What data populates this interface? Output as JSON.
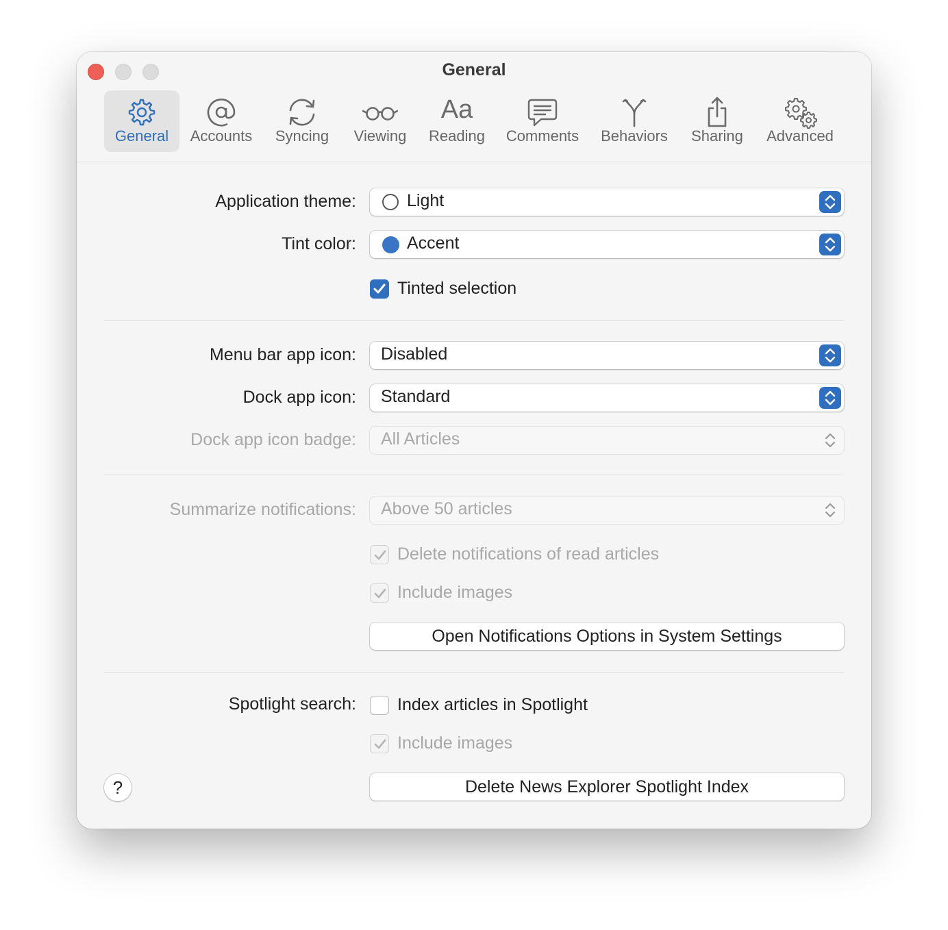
{
  "window": {
    "title": "General"
  },
  "toolbar": {
    "tabs": [
      {
        "label": "General",
        "icon": "gear-icon",
        "active": true
      },
      {
        "label": "Accounts",
        "icon": "at-sign-icon"
      },
      {
        "label": "Syncing",
        "icon": "sync-arrows-icon"
      },
      {
        "label": "Viewing",
        "icon": "glasses-icon"
      },
      {
        "label": "Reading",
        "icon": "text-aa-icon",
        "glyph": "Aa"
      },
      {
        "label": "Comments",
        "icon": "speech-bubble-icon"
      },
      {
        "label": "Behaviors",
        "icon": "fork-arrows-icon"
      },
      {
        "label": "Sharing",
        "icon": "share-icon"
      },
      {
        "label": "Advanced",
        "icon": "gears-icon"
      }
    ]
  },
  "settings": {
    "app_theme": {
      "label": "Application theme:",
      "value": "Light"
    },
    "tint_color": {
      "label": "Tint color:",
      "value": "Accent",
      "color": "#3a74c4"
    },
    "tinted_selection": {
      "label": "Tinted selection",
      "checked": true
    },
    "menu_bar_icon": {
      "label": "Menu bar app icon:",
      "value": "Disabled"
    },
    "dock_icon": {
      "label": "Dock app icon:",
      "value": "Standard"
    },
    "dock_badge": {
      "label": "Dock app icon badge:",
      "value": "All Articles",
      "enabled": false
    },
    "summarize": {
      "label": "Summarize notifications:",
      "value": "Above 50 articles",
      "enabled": false
    },
    "delete_read": {
      "label": "Delete notifications of read articles",
      "checked": true,
      "enabled": false
    },
    "notif_images": {
      "label": "Include images",
      "checked": true,
      "enabled": false
    },
    "open_notif_button": "Open Notifications Options in System Settings",
    "spotlight": {
      "label": "Spotlight search:",
      "option": "Index articles in Spotlight",
      "checked": false
    },
    "spotlight_images": {
      "label": "Include images",
      "checked": true,
      "enabled": false
    },
    "delete_index_button": "Delete News Explorer Spotlight Index",
    "help": "?"
  },
  "colors": {
    "accent": "#2f6fbd",
    "close": "#ee5f58"
  }
}
